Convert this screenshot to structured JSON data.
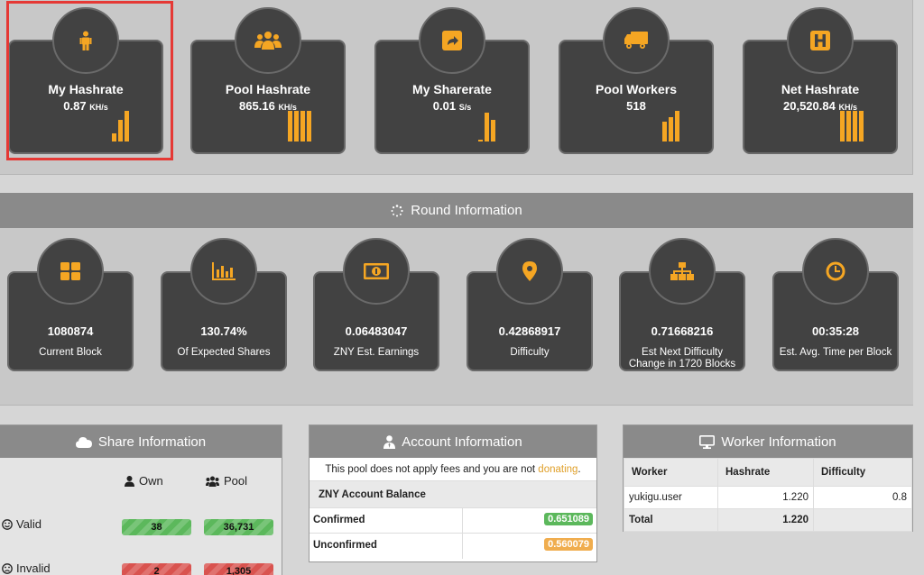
{
  "top_stats": [
    {
      "title": "My Hashrate",
      "value": "0.87",
      "unit": "KH/s",
      "icon": "person-icon",
      "bars": [
        0.25,
        0.7,
        1.0
      ]
    },
    {
      "title": "Pool Hashrate",
      "value": "865.16",
      "unit": "KH/s",
      "icon": "group-icon",
      "bars": [
        1.0,
        1.0,
        1.0,
        1.0
      ]
    },
    {
      "title": "My Sharerate",
      "value": "0.01",
      "unit": "S/s",
      "icon": "share-icon",
      "bars": [
        0.05,
        0.95,
        0.7
      ]
    },
    {
      "title": "Pool Workers",
      "value": "518",
      "unit": "",
      "icon": "truck-icon",
      "bars": [
        0.65,
        0.8,
        1.0
      ]
    },
    {
      "title": "Net Hashrate",
      "value": "20,520.84",
      "unit": "KH/s",
      "icon": "h-square-icon",
      "bars": [
        1.0,
        1.0,
        1.0,
        1.0
      ]
    }
  ],
  "round": {
    "title": "Round Information",
    "icon": "spinner-icon",
    "cards": [
      {
        "value": "1080874",
        "label": "Current Block",
        "icon": "grid-icon"
      },
      {
        "value": "130.74%",
        "label": "Of Expected Shares",
        "icon": "bar-chart-icon"
      },
      {
        "value": "0.06483047",
        "label": "ZNY Est. Earnings",
        "icon": "money-icon"
      },
      {
        "value": "0.42868917",
        "label": "Difficulty",
        "icon": "map-pin-icon"
      },
      {
        "value": "0.71668216",
        "label": "Est Next Difficulty Change in 1720 Blocks",
        "icon": "sitemap-icon"
      },
      {
        "value": "00:35:28",
        "label": "Est. Avg. Time per Block",
        "icon": "clock-icon"
      }
    ]
  },
  "share_info": {
    "title": "Share Information",
    "icon": "cloud-icon",
    "own_label": "Own",
    "pool_label": "Pool",
    "valid_label": "Valid",
    "invalid_label": "Invalid",
    "valid_own": "38",
    "valid_pool": "36,731",
    "invalid_own": "2",
    "invalid_pool": "1,305"
  },
  "account_info": {
    "title": "Account Information",
    "icon": "user-tie-icon",
    "note_prefix": "This pool does not apply fees and you are not ",
    "note_link": "donating",
    "note_suffix": ".",
    "balance_title": "ZNY Account Balance",
    "confirmed_label": "Confirmed",
    "confirmed_value": "0.651089",
    "unconfirmed_label": "Unconfirmed",
    "unconfirmed_value": "0.560079"
  },
  "worker_info": {
    "title": "Worker Information",
    "icon": "desktop-icon",
    "headers": [
      "Worker",
      "Hashrate",
      "Difficulty"
    ],
    "rows": [
      {
        "worker": "yukigu.user",
        "hashrate": "1.220",
        "difficulty": "0.8"
      }
    ],
    "total_label": "Total",
    "total_hashrate": "1.220"
  },
  "colors": {
    "accent": "#f5a623",
    "card_bg": "#424242",
    "header_bg": "#8a8a8a",
    "valid": "#5cb85c",
    "invalid": "#d9534f",
    "highlight": "#e53935"
  }
}
